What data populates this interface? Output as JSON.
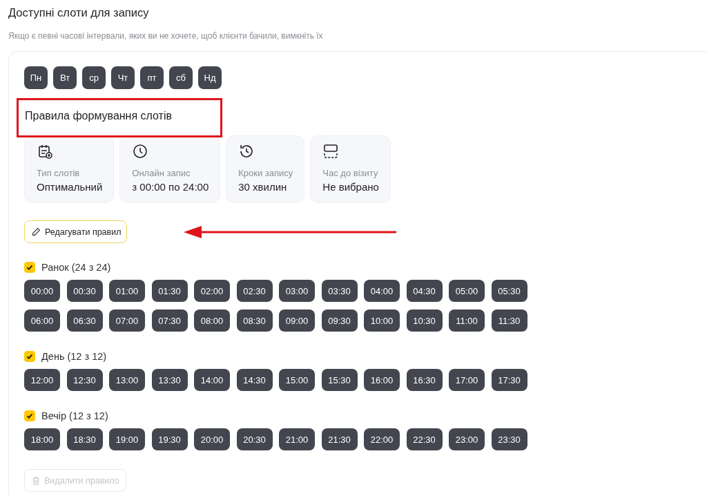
{
  "header": {
    "title": "Доступні слоти для запису",
    "subtitle": "Якщо є певні часові інтервали, яких ви не хочете, щоб клієнти бачили, вимкніть їх"
  },
  "days": [
    "Пн",
    "Вт",
    "ср",
    "Чт",
    "пт",
    "сб",
    "Нд"
  ],
  "rules": {
    "title": "Правила формування слотів",
    "cards": [
      {
        "kind": "calendar",
        "label": "Тип слотів",
        "value": "Оптимальний"
      },
      {
        "kind": "clock",
        "label": "Онлайн запис",
        "value": "з 00:00 по 24:00"
      },
      {
        "kind": "history",
        "label": "Кроки запису",
        "value": "30 хвилин"
      },
      {
        "kind": "layout",
        "label": "Час до візиту",
        "value": "Не вибрано"
      }
    ],
    "edit_button": "Редагувати правил"
  },
  "groups": [
    {
      "label": "Ранок (24 з 24)",
      "checked": true,
      "slots": [
        "00:00",
        "00:30",
        "01:00",
        "01:30",
        "02:00",
        "02:30",
        "03:00",
        "03:30",
        "04:00",
        "04:30",
        "05:00",
        "05:30",
        "06:00",
        "06:30",
        "07:00",
        "07:30",
        "08:00",
        "08:30",
        "09:00",
        "09:30",
        "10:00",
        "10:30",
        "11:00",
        "11:30"
      ]
    },
    {
      "label": "День (12 з 12)",
      "checked": true,
      "slots": [
        "12:00",
        "12:30",
        "13:00",
        "13:30",
        "14:00",
        "14:30",
        "15:00",
        "15:30",
        "16:00",
        "16:30",
        "17:00",
        "17:30"
      ]
    },
    {
      "label": "Вечір (12 з 12)",
      "checked": true,
      "slots": [
        "18:00",
        "18:30",
        "19:00",
        "19:30",
        "20:00",
        "20:30",
        "21:00",
        "21:30",
        "22:00",
        "22:30",
        "23:00",
        "23:30"
      ]
    }
  ],
  "delete_button": {
    "label": "Видалити правило",
    "disabled": true
  }
}
